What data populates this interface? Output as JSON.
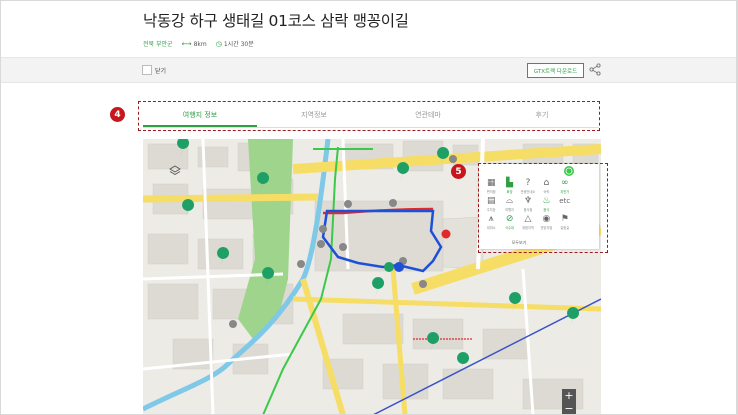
{
  "title": "낙동강 하구 생태길 01코스 삼락 맹꽁이길",
  "meta": {
    "region": "전북 부안군",
    "distance_icon": "distance-arrow-icon",
    "distance": "8km",
    "time_icon": "clock-icon",
    "time": "1시간 30분"
  },
  "toolbar": {
    "checkbox_label": "닫기",
    "gtx_button": "GTX트랙 다운로드",
    "share_icon": "share-icon"
  },
  "annotations": {
    "marker_tabs": "4",
    "marker_poi": "5",
    "color": "#c8161d"
  },
  "tabs": [
    {
      "label": "여행지 정보",
      "active": true
    },
    {
      "label": "지역정보",
      "active": false
    },
    {
      "label": "연관테마",
      "active": false
    },
    {
      "label": "후기",
      "active": false
    }
  ],
  "poi": {
    "info_icon": "info-circle-icon",
    "items": [
      {
        "label": "편의점",
        "icon": "store-icon",
        "active": false
      },
      {
        "label": "화장",
        "icon": "restroom-icon",
        "active": true
      },
      {
        "label": "관광안내소",
        "icon": "info-booth-icon",
        "active": false
      },
      {
        "label": "숙박",
        "icon": "lodging-icon",
        "active": false
      },
      {
        "label": "자전거",
        "icon": "bicycle-icon",
        "active": true
      },
      {
        "label": "주차장",
        "icon": "parking-icon",
        "active": false
      },
      {
        "label": "여행지",
        "icon": "landmark-icon",
        "active": false
      },
      {
        "label": "음식점",
        "icon": "restaurant-icon",
        "active": false
      },
      {
        "label": "음식",
        "icon": "food-icon",
        "active": true
      },
      {
        "label": "etc",
        "icon": "etc-icon",
        "active": false
      },
      {
        "label": "대피소",
        "icon": "shelter-icon",
        "active": false
      },
      {
        "label": "식수대",
        "icon": "water-icon",
        "active": true
      },
      {
        "label": "위험지역",
        "icon": "warning-icon",
        "active": false
      },
      {
        "label": "전망지점",
        "icon": "viewpoint-icon",
        "active": false
      },
      {
        "label": "갈림길",
        "icon": "fork-icon",
        "active": false
      }
    ],
    "show_all": "모두보기"
  },
  "map": {
    "layer_icon": "layers-icon",
    "zoom_in": "+",
    "zoom_out": "−",
    "colors": {
      "route": "#1e4fd8",
      "highlight": "#e0292a",
      "park": "#9ed48b",
      "road": "#f6dd66",
      "tourist_marker": "#1e9f65"
    }
  }
}
